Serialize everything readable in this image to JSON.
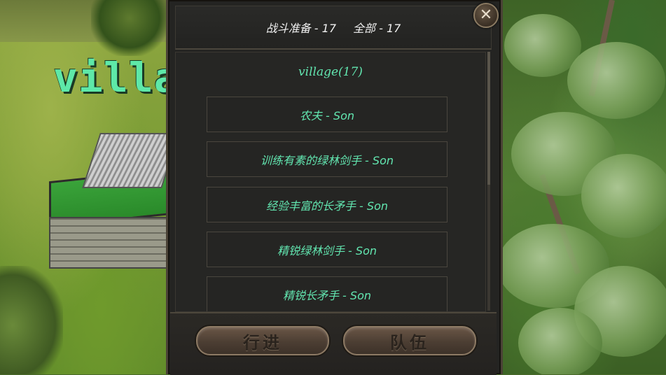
{
  "scene": {
    "map_label": "villag"
  },
  "header": {
    "ready_label": "战斗准备 - 17",
    "all_label": "全部 - 17"
  },
  "close_glyph": "✕",
  "group": {
    "title": "village(17)"
  },
  "units": [
    {
      "label": "农夫 - Son"
    },
    {
      "label": "训练有素的绿林剑手 - Son"
    },
    {
      "label": "经验丰富的长矛手 - Son"
    },
    {
      "label": "精锐绿林剑手 - Son"
    },
    {
      "label": "精锐长矛手 - Son"
    }
  ],
  "footer": {
    "march_label": "行进",
    "party_label": "队伍"
  },
  "colors": {
    "unit_text": "#62e6b0",
    "panel_bg": "#242422",
    "button_bg": "#4c3e33"
  }
}
